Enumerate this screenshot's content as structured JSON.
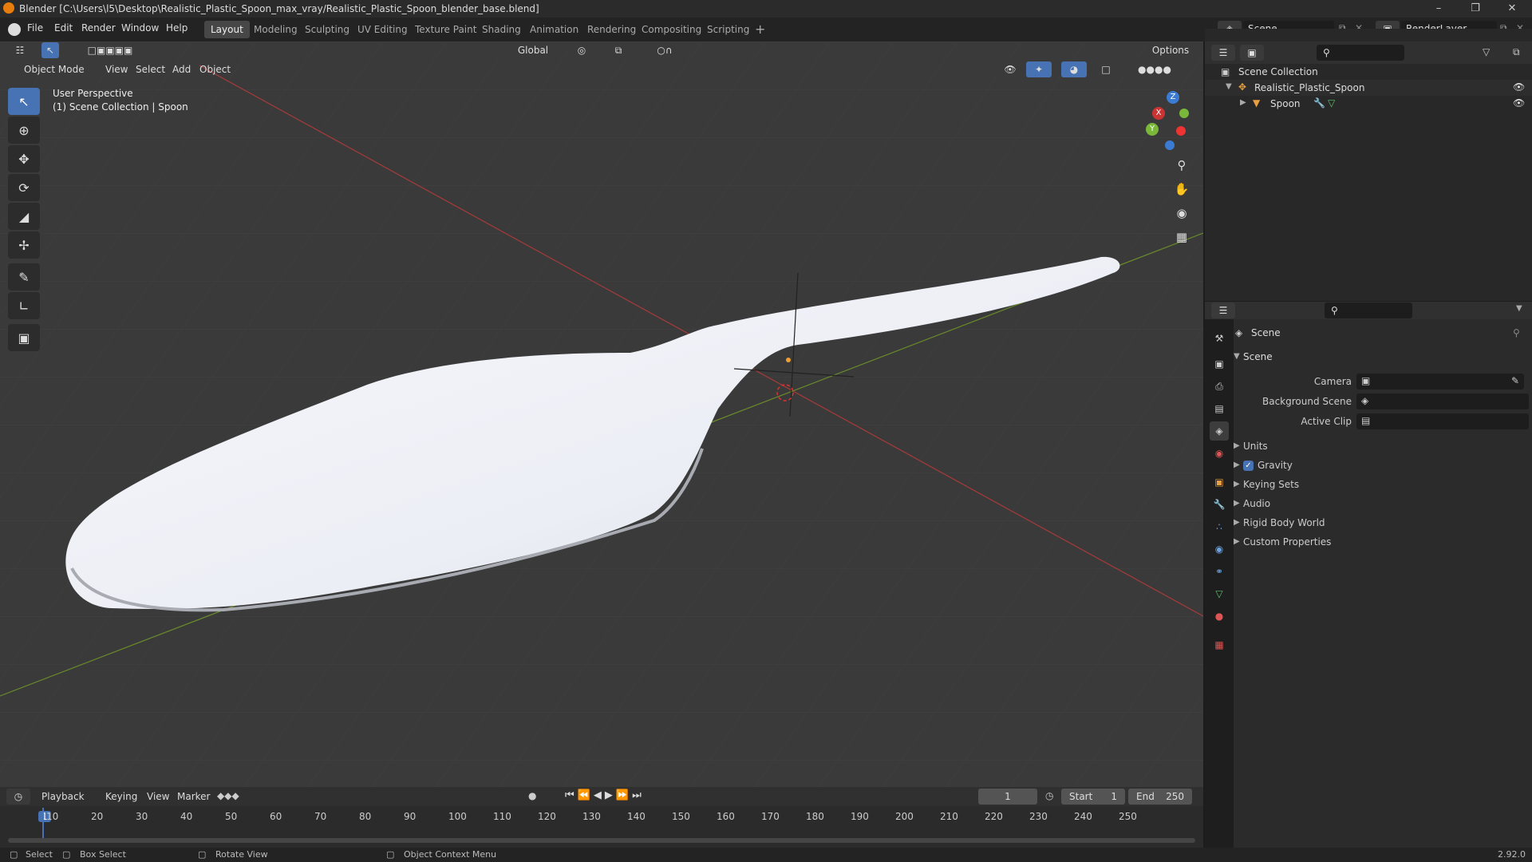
{
  "window": {
    "title": "Blender [C:\\Users\\l5\\Desktop\\Realistic_Plastic_Spoon_max_vray/Realistic_Plastic_Spoon_blender_base.blend]"
  },
  "menu": [
    "File",
    "Edit",
    "Render",
    "Window",
    "Help"
  ],
  "workspaces": [
    "Layout",
    "Modeling",
    "Sculpting",
    "UV Editing",
    "Texture Paint",
    "Shading",
    "Animation",
    "Rendering",
    "Compositing",
    "Scripting"
  ],
  "topright": {
    "scene": "Scene",
    "renderlayer": "RenderLayer"
  },
  "viewport": {
    "transform_orientation": "Global",
    "options": "Options",
    "mode": "Object Mode",
    "menus": [
      "View",
      "Select",
      "Add",
      "Object"
    ],
    "overlay_line1": "User Perspective",
    "overlay_line2": "(1) Scene Collection | Spoon",
    "gizmo": {
      "x": "X",
      "y": "Y",
      "z": "Z"
    }
  },
  "outliner": {
    "root": "Scene Collection",
    "items": [
      {
        "label": "Realistic_Plastic_Spoon"
      },
      {
        "label": "Spoon"
      }
    ]
  },
  "properties": {
    "context": "Scene",
    "section": "Scene",
    "fields": [
      {
        "label": "Camera"
      },
      {
        "label": "Background Scene"
      },
      {
        "label": "Active Clip"
      }
    ],
    "panels": [
      "Units",
      "Gravity",
      "Keying Sets",
      "Audio",
      "Rigid Body World",
      "Custom Properties"
    ],
    "gravity_checked": true
  },
  "timeline": {
    "menus": [
      "Playback",
      "Keying",
      "View",
      "Marker"
    ],
    "current_frame": "1",
    "start_label": "Start",
    "start": "1",
    "end_label": "End",
    "end": "250",
    "ticks": [
      "1",
      "10",
      "20",
      "30",
      "40",
      "50",
      "60",
      "70",
      "80",
      "90",
      "100",
      "110",
      "120",
      "130",
      "140",
      "150",
      "160",
      "170",
      "180",
      "190",
      "200",
      "210",
      "220",
      "230",
      "240",
      "250"
    ]
  },
  "status": {
    "select": "Select",
    "box_select": "Box Select",
    "rotate": "Rotate View",
    "context_menu": "Object Context Menu",
    "version": "2.92.0"
  }
}
